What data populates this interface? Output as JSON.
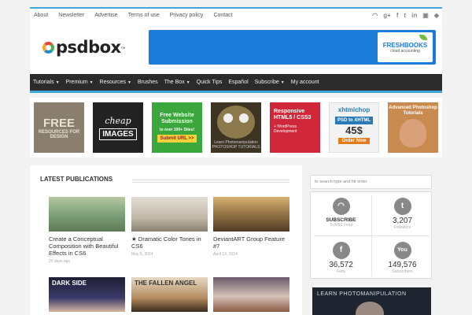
{
  "topbar": {
    "links": [
      "About",
      "Newsletter",
      "Advertise",
      "Terms of use",
      "Privacy policy",
      "Contact"
    ],
    "social_icons": [
      "rss-icon",
      "google-plus-icon",
      "facebook-icon",
      "twitter-icon",
      "linkedin-icon",
      "youtube-icon",
      "delicious-icon"
    ]
  },
  "logo": {
    "text": "psdbox",
    "tm": "TM"
  },
  "banner": {
    "brand": "FRESHBOOKS",
    "tagline": "cloud accounting"
  },
  "nav": {
    "items": [
      {
        "label": "Tutorials",
        "dropdown": true
      },
      {
        "label": "Premium",
        "dropdown": true
      },
      {
        "label": "Resources",
        "dropdown": true
      },
      {
        "label": "Brushes",
        "dropdown": false
      },
      {
        "label": "The Box",
        "dropdown": true
      },
      {
        "label": "Quick Tips",
        "dropdown": false
      },
      {
        "label": "Español",
        "dropdown": false
      },
      {
        "label": "Subscribe",
        "dropdown": true
      },
      {
        "label": "My account",
        "dropdown": false
      }
    ]
  },
  "ads": {
    "ad1": {
      "a": "FREE",
      "b": "RESOURCES FOR DESIGN"
    },
    "ad2": {
      "a": "cheap",
      "b": "IMAGES"
    },
    "ad3": {
      "a": "Free Website Submission",
      "b": "to over 100+ Sites!",
      "c": "Submit URL >>"
    },
    "ad4": {
      "a": "Learn Photomanipulation PHOTOSHOP TUTORIALS"
    },
    "ad5": {
      "a": "Responsive HTML5 / CSS3",
      "b": "+ WordPress Development"
    },
    "ad6": {
      "a": "xhtmlchop",
      "b": "PSD to XHTML",
      "c": "45$",
      "d": "Order Now"
    },
    "ad7": {
      "a": "Advanced Photoshop Tutorials"
    }
  },
  "main": {
    "heading": "LATEST PUBLICATIONS",
    "posts": [
      {
        "title": "Create a Conceptual Composition with Beautiful Effects in CS6",
        "date": "26 days ago"
      },
      {
        "title": "★ Dramatic Color Tones in CS6",
        "date": "May 5, 2014"
      },
      {
        "title": "DeviantART Group Feature #7",
        "date": "April 13, 2014"
      },
      {
        "title": "",
        "date": "",
        "img_text": "DARK SIDE"
      },
      {
        "title": "",
        "date": "",
        "img_text": "THE FALLEN ANGEL"
      },
      {
        "title": "",
        "date": ""
      }
    ]
  },
  "sidebar": {
    "search_placeholder": "to search type and hit enter",
    "social": [
      {
        "icon": "rss-icon",
        "glyph": "◠",
        "value": "SUBSCRIBE",
        "label": "To RSS Feed",
        "color": "#8c8c8c"
      },
      {
        "icon": "twitter-icon",
        "glyph": "t",
        "value": "3,207",
        "label": "Followers",
        "color": "#8c8c8c"
      },
      {
        "icon": "facebook-icon",
        "glyph": "f",
        "value": "36,572",
        "label": "Fans",
        "color": "#8c8c8c"
      },
      {
        "icon": "youtube-icon",
        "glyph": "You",
        "value": "149,576",
        "label": "Subscribers",
        "color": "#8c8c8c"
      }
    ],
    "photo_text": "LEARN PHOTOMANIPULATION"
  },
  "colors": {
    "accent": "#3ea6d8",
    "nav_bg": "#2b2b2b"
  }
}
